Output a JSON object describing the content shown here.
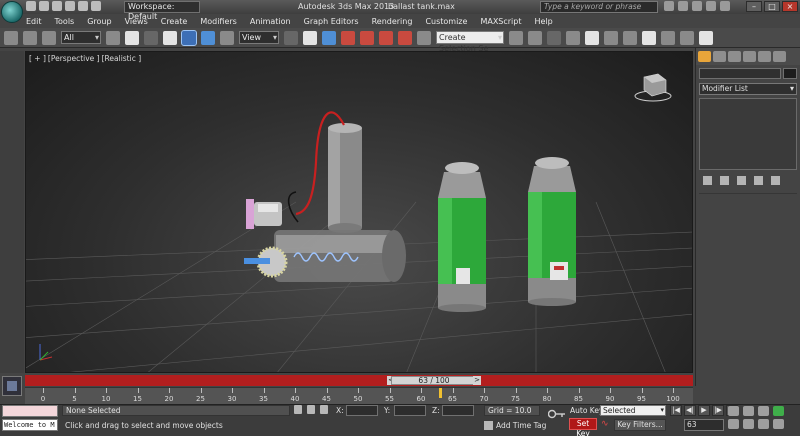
{
  "titlebar": {
    "workspace": "Workspace: Default",
    "app_title": "Autodesk 3ds Max  2013",
    "file_name": "ballast tank.max",
    "search_placeholder": "Type a keyword or phrase"
  },
  "menu": {
    "items": [
      "Edit",
      "Tools",
      "Group",
      "Views",
      "Create",
      "Modifiers",
      "Animation",
      "Graph Editors",
      "Rendering",
      "Customize",
      "MAXScript",
      "Help"
    ]
  },
  "toolbar": {
    "filter": "All",
    "ref_coord": "View",
    "selection_set": "Create Selection Se"
  },
  "viewport": {
    "label_plus": "[ + ]",
    "label_view": "[Perspective ]",
    "label_shading": "[Realistic ]"
  },
  "command_panel": {
    "modifier_list": "Modifier List"
  },
  "timeline": {
    "frame_display": "63 / 100",
    "prev": "<",
    "next": ">",
    "ticks": [
      "0",
      "5",
      "10",
      "15",
      "20",
      "25",
      "30",
      "35",
      "40",
      "45",
      "50",
      "55",
      "60",
      "65",
      "70",
      "75",
      "80",
      "85",
      "90",
      "95",
      "100"
    ],
    "current_frame": 63,
    "total_frames": 100
  },
  "status": {
    "listener_text": "Welcome to M",
    "selection": "None Selected",
    "prompt": "Click and drag to select and move objects",
    "x_label": "X:",
    "y_label": "Y:",
    "z_label": "Z:",
    "grid": "Grid = 10.0",
    "add_time_tag": "Add Time Tag",
    "auto_key": "Auto Key",
    "set_key": "Set Key",
    "key_mode": "Selected",
    "key_filters": "Key Filters...",
    "frame": "63"
  },
  "colors": {
    "time_slider": "#b21e1e",
    "tank_green": "#2da83a",
    "wire_red": "#c82020",
    "active_tab": "#e8a53a"
  }
}
